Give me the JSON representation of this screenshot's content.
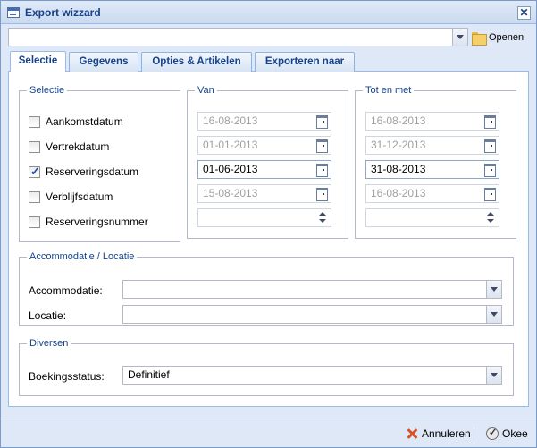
{
  "window": {
    "title": "Export wizzard"
  },
  "toolbar": {
    "template_value": "",
    "open_label": "Openen"
  },
  "tabs": [
    {
      "label": "Selectie",
      "active": true
    },
    {
      "label": "Gegevens",
      "active": false
    },
    {
      "label": "Opties & Artikelen",
      "active": false
    },
    {
      "label": "Exporteren naar",
      "active": false
    }
  ],
  "selectie": {
    "legend": "Selectie",
    "items": [
      {
        "label": "Aankomstdatum",
        "checked": false
      },
      {
        "label": "Vertrekdatum",
        "checked": false
      },
      {
        "label": "Reserveringsdatum",
        "checked": true
      },
      {
        "label": "Verblijfsdatum",
        "checked": false
      },
      {
        "label": "Reserveringsnummer",
        "checked": false
      }
    ]
  },
  "van": {
    "legend": "Van",
    "values": [
      "16-08-2013",
      "01-01-2013",
      "01-06-2013",
      "15-08-2013",
      ""
    ]
  },
  "tot": {
    "legend": "Tot en met",
    "values": [
      "16-08-2013",
      "31-12-2013",
      "31-08-2013",
      "16-08-2013",
      ""
    ]
  },
  "accommodatie": {
    "legend": "Accommodatie / Locatie",
    "accommodatie_label": "Accommodatie:",
    "accommodatie_value": "",
    "locatie_label": "Locatie:",
    "locatie_value": ""
  },
  "diversen": {
    "legend": "Diversen",
    "boekingsstatus_label": "Boekingsstatus:",
    "boekingsstatus_value": "Definitief"
  },
  "footer": {
    "cancel_label": "Annuleren",
    "ok_label": "Okee"
  },
  "colors": {
    "title_text": "#15428b",
    "window_bg": "#dfe8f6",
    "border": "#99bbe8",
    "cancel_icon": "#d7542a"
  }
}
